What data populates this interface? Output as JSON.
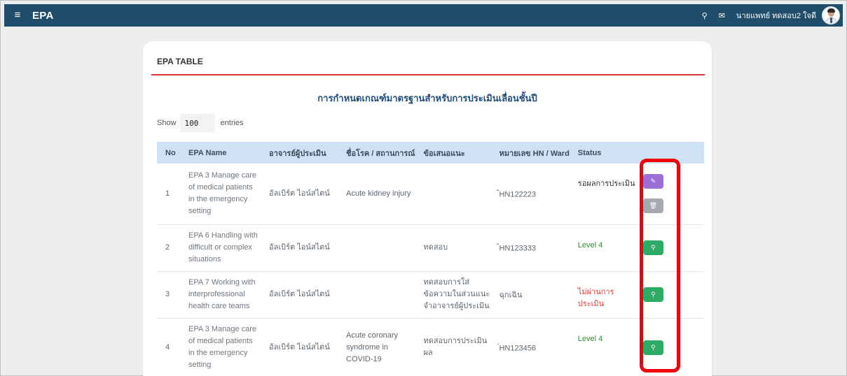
{
  "header": {
    "menu_icon": "≡",
    "app_title": "EPA",
    "location_icon": "⚲",
    "mail_icon": "✉",
    "user_name": "นายแพทย์ ทดสอบ2 ใจดี"
  },
  "card": {
    "title": "EPA TABLE",
    "table_title": "การกำหนดเกณฑ์มาตรฐานสำหรับการประเมินเลื่อนชั้นปี"
  },
  "entries": {
    "show_label": "Show",
    "value": "100",
    "suffix": "entries"
  },
  "table": {
    "headers": [
      "No",
      "EPA Name",
      "อาจารย์ผู้ประเมิน",
      "ชื่อโรค / สถานการณ์",
      "ข้อเสนอแนะ",
      "หมายเลข HN / Ward",
      "Status"
    ],
    "rows": [
      {
        "no": "1",
        "epa_name": "EPA 3 Manage care of medical patients in the emergency setting",
        "teacher": "อัลเบิร์ต ไอน์สไตน์",
        "diagnosis": "Acute kidney injury",
        "suggestion": "",
        "hn_prefix": "ี",
        "hn": "HN122223",
        "status": "รอผลการประเมิน"
      },
      {
        "no": "2",
        "epa_name": "EPA 6 Handling with difficult or complex situations",
        "teacher": "อัลเบิร์ต ไอน์สไตน์",
        "diagnosis": "",
        "suggestion": "ทดสอบ",
        "hn_prefix": "ี",
        "hn": "HN123333",
        "status": "Level 4"
      },
      {
        "no": "3",
        "epa_name": "EPA 7 Working with interprofessional health care teams",
        "teacher": "อัลเบิร์ต ไอน์สไตน์",
        "diagnosis": "",
        "suggestion": "ทดสอบการใส่ข้อความในส่วนแนะจำอาจารย์ผู้ประเมิน",
        "hn_prefix": "",
        "hn": "ฉุกเฉิน",
        "status": "ไม่ผ่านการประเมิน"
      },
      {
        "no": "4",
        "epa_name": "EPA 3 Manage care of medical patients in the emergency setting",
        "teacher": "อัลเบิร์ต ไอน์สไตน์",
        "diagnosis": "Acute coronary syndrome in COVID-19",
        "suggestion": "ทดสอบการประเมินผล",
        "hn_prefix": "ั",
        "hn": "HN123456",
        "status": "Level 4"
      }
    ]
  },
  "icons": {
    "edit": "✎",
    "delete": "🗑",
    "view": "⚲"
  },
  "colors": {
    "topbar": "#1f4d6a",
    "header_row": "#cfe2f3",
    "divider": "#d9353b",
    "edit_button": "#9b6fd6",
    "delete_button": "#a4aab0",
    "view_button": "#2bab63",
    "level_status": "#2e8b2e",
    "fail_status": "#e23a3a",
    "highlight": "#f0000a"
  }
}
